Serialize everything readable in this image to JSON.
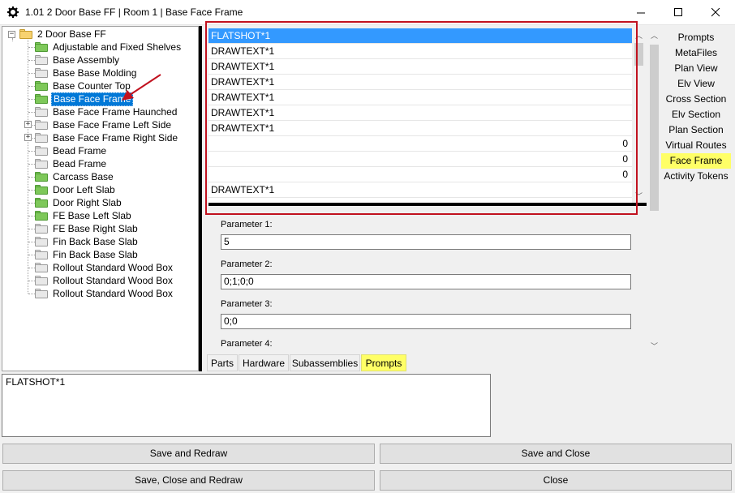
{
  "window": {
    "title": "1.01 2 Door Base FF | Room 1 | Base Face Frame",
    "icon": "gear-icon",
    "controls": [
      "minimize-icon",
      "maximize-icon",
      "close-icon"
    ]
  },
  "tree": {
    "root": "2 Door Base FF",
    "items": [
      {
        "label": "Adjustable and Fixed Shelves",
        "folder": "green"
      },
      {
        "label": "Base Assembly",
        "folder": "gray"
      },
      {
        "label": "Base Base Molding",
        "folder": "gray"
      },
      {
        "label": "Base Counter Top",
        "folder": "green"
      },
      {
        "label": "Base Face Frame",
        "folder": "green",
        "selected": true
      },
      {
        "label": "Base Face Frame Haunched",
        "folder": "gray"
      },
      {
        "label": "Base Face Frame Left Side",
        "folder": "gray",
        "expandable": true
      },
      {
        "label": "Base Face Frame Right Side",
        "folder": "gray",
        "expandable": true
      },
      {
        "label": "Bead Frame",
        "folder": "gray"
      },
      {
        "label": "Bead Frame",
        "folder": "gray"
      },
      {
        "label": "Carcass Base",
        "folder": "green"
      },
      {
        "label": "Door Left Slab",
        "folder": "green"
      },
      {
        "label": "Door Right Slab",
        "folder": "green"
      },
      {
        "label": "FE Base Left Slab",
        "folder": "green"
      },
      {
        "label": "FE Base Right Slab",
        "folder": "gray"
      },
      {
        "label": "Fin Back Base Slab",
        "folder": "gray"
      },
      {
        "label": "Fin Back Base Slab",
        "folder": "gray"
      },
      {
        "label": "Rollout Standard Wood Box",
        "folder": "gray"
      },
      {
        "label": "Rollout Standard Wood Box",
        "folder": "gray"
      },
      {
        "label": "Rollout Standard Wood Box",
        "folder": "gray"
      }
    ]
  },
  "list": {
    "rows": [
      {
        "text": "FLATSHOT*1",
        "selected": true
      },
      {
        "text": "DRAWTEXT*1"
      },
      {
        "text": "DRAWTEXT*1"
      },
      {
        "text": "DRAWTEXT*1"
      },
      {
        "text": "DRAWTEXT*1"
      },
      {
        "text": "DRAWTEXT*1"
      },
      {
        "text": "DRAWTEXT*1"
      },
      {
        "text": "0",
        "numeric": true
      },
      {
        "text": "0",
        "numeric": true
      },
      {
        "text": "0",
        "numeric": true
      },
      {
        "text": "DRAWTEXT*1"
      }
    ]
  },
  "parameters": [
    {
      "label": "Parameter 1:",
      "value": "5"
    },
    {
      "label": "Parameter 2:",
      "value": "0;1;0;0"
    },
    {
      "label": "Parameter 3:",
      "value": "0;0"
    },
    {
      "label": "Parameter 4:"
    }
  ],
  "nav": [
    {
      "label": "Prompts"
    },
    {
      "label": "MetaFiles"
    },
    {
      "label": "Plan View"
    },
    {
      "label": "Elv View"
    },
    {
      "label": "Cross Section"
    },
    {
      "label": "Elv Section"
    },
    {
      "label": "Plan Section"
    },
    {
      "label": "Virtual Routes"
    },
    {
      "label": "Face Frame",
      "active": true
    },
    {
      "label": "Activity Tokens"
    }
  ],
  "tabs": [
    {
      "label": "Parts"
    },
    {
      "label": "Hardware"
    },
    {
      "label": "Subassemblies"
    },
    {
      "label": "Prompts",
      "active": true
    }
  ],
  "textarea": {
    "value": "FLATSHOT*1"
  },
  "buttons": {
    "save_redraw": "Save and Redraw",
    "save_close": "Save and Close",
    "save_close_redraw": "Save, Close and Redraw",
    "close": "Close"
  },
  "colors": {
    "selection": "#0078d7",
    "list_selection": "#3399ff",
    "highlight": "#ffff66",
    "annotation": "#c1121f"
  }
}
